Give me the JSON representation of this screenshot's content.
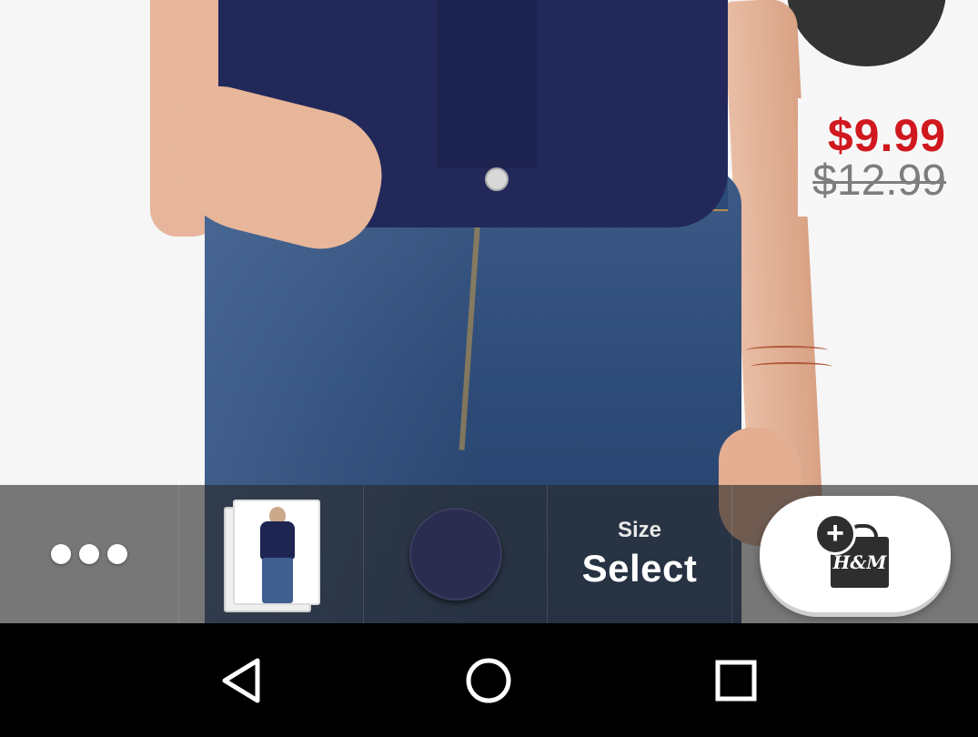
{
  "product": {
    "image_alt": "Model wearing navy top and blue skinny jeans",
    "price": {
      "sale": "$9.99",
      "original": "$12.99",
      "sale_color": "#d0181e",
      "original_color": "#7d7d7d"
    }
  },
  "toolbar": {
    "more_icon": "more-dots-icon",
    "thumbnail_icon": "product-thumbnail",
    "color_swatch": {
      "color": "#2a2d4f"
    },
    "size": {
      "label": "Size",
      "value": "Select"
    },
    "add_to_bag_icon": "add-to-bag-icon",
    "add_to_bag_brand": "H&M"
  },
  "system_nav": {
    "back_icon": "back-triangle-icon",
    "home_icon": "home-circle-icon",
    "recents_icon": "recents-square-icon"
  }
}
